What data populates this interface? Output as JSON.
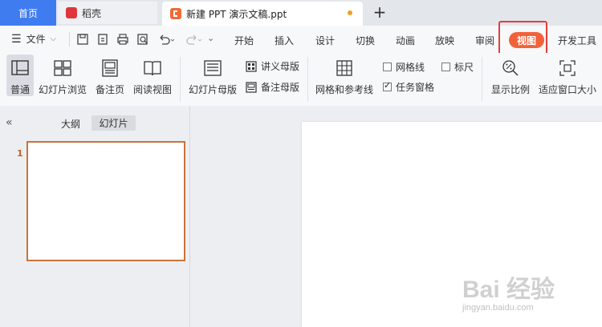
{
  "tabs": {
    "home": "首页",
    "daoke": "稻壳",
    "doc": "新建 PPT 演示文稿.ppt",
    "new_tab": "+"
  },
  "menu": {
    "file_label": "文件",
    "tabs": [
      "开始",
      "插入",
      "设计",
      "切换",
      "动画",
      "放映",
      "审阅",
      "视图",
      "开发工具"
    ],
    "active_tab": "视图"
  },
  "ribbon": {
    "normal": "普通",
    "slide_sorter": "幻灯片浏览",
    "notes_page": "备注页",
    "reading_view": "阅读视图",
    "slide_master": "幻灯片母版",
    "handout_master": "讲义母版",
    "notes_master": "备注母版",
    "grid_guides": "网格和参考线",
    "gridlines": "网格线",
    "ruler": "标尺",
    "task_pane": "任务窗格",
    "zoom": "显示比例",
    "fit_window": "适应窗口大小",
    "gridlines_checked": false,
    "ruler_checked": false,
    "task_pane_checked": true
  },
  "panel": {
    "collapse": "«",
    "outline_tab": "大纲",
    "slides_tab": "幻灯片",
    "slide_number": "1"
  },
  "watermark": {
    "main": "Bai 经验",
    "sub": "jingyan.baidu.com"
  },
  "colors": {
    "accent_tab": "#3f7cf0",
    "view_pill": "#f2623a",
    "highlight": "#e43c3c",
    "thumb_border": "#c8733c"
  }
}
